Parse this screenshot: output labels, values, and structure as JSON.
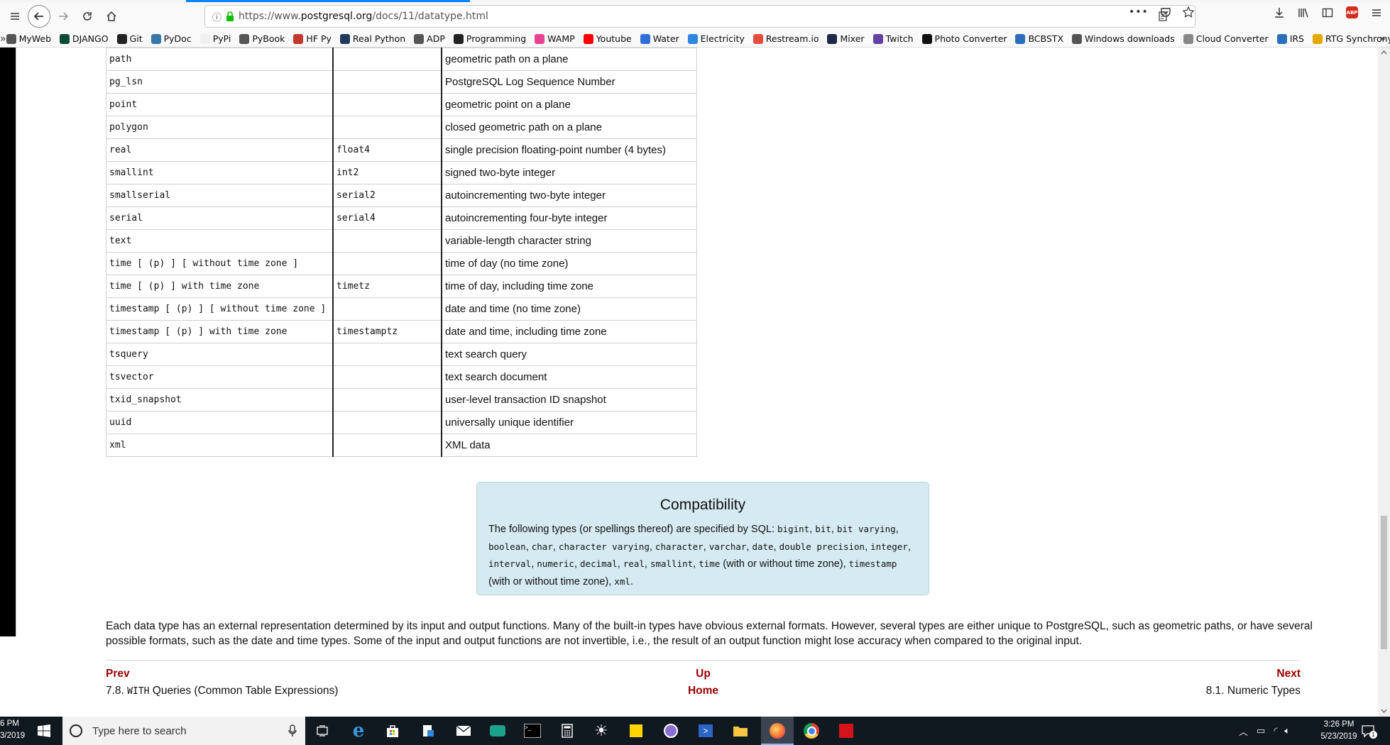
{
  "browser": {
    "url_prefix": "https://www.",
    "url_domain": "postgresql.org",
    "url_path": "/docs/11/datatype.html",
    "bookmarks": [
      {
        "label": "MyWeb",
        "icon": "globe-icon",
        "color": "#555555"
      },
      {
        "label": "DJANGO",
        "icon": "django-icon",
        "color": "#0c4b33"
      },
      {
        "label": "Git",
        "icon": "github-icon",
        "color": "#222222"
      },
      {
        "label": "PyDoc",
        "icon": "python-icon",
        "color": "#3776ab"
      },
      {
        "label": "PyPi",
        "icon": "pypi-icon",
        "color": "#f0f0f0"
      },
      {
        "label": "PyBook",
        "icon": "globe-icon",
        "color": "#555555"
      },
      {
        "label": "HF Py",
        "icon": "book-icon",
        "color": "#c0392b"
      },
      {
        "label": "Real Python",
        "icon": "realpython-icon",
        "color": "#1f3a5a"
      },
      {
        "label": "ADP",
        "icon": "globe-icon",
        "color": "#555555"
      },
      {
        "label": "Programming",
        "icon": "terminal-icon",
        "color": "#222222"
      },
      {
        "label": "WAMP",
        "icon": "wamp-icon",
        "color": "#e84393"
      },
      {
        "label": "Youtube",
        "icon": "youtube-icon",
        "color": "#ff0000"
      },
      {
        "label": "Water",
        "icon": "water-icon",
        "color": "#2e6fd8"
      },
      {
        "label": "Electricity",
        "icon": "bolt-icon",
        "color": "#2e86de"
      },
      {
        "label": "Restream.io",
        "icon": "restream-icon",
        "color": "#e74c3c"
      },
      {
        "label": "Mixer",
        "icon": "mixer-icon",
        "color": "#1c2b4a"
      },
      {
        "label": "Twitch",
        "icon": "twitch-icon",
        "color": "#6441a5"
      },
      {
        "label": "Photo Converter",
        "icon": "photo-icon",
        "color": "#111111"
      },
      {
        "label": "BCBSTX",
        "icon": "bcbs-icon",
        "color": "#2a6ebb"
      },
      {
        "label": "Windows downloads",
        "icon": "folder-icon",
        "color": "#555555"
      },
      {
        "label": "Cloud Converter",
        "icon": "cloud-icon",
        "color": "#888888"
      },
      {
        "label": "IRS",
        "icon": "irs-icon",
        "color": "#2a6ebb"
      },
      {
        "label": "RTG Synchrony",
        "icon": "rtg-icon",
        "color": "#e6a700"
      }
    ]
  },
  "table_rows": [
    {
      "name": "path",
      "alias": "",
      "desc": "geometric path on a plane"
    },
    {
      "name": "pg_lsn",
      "alias": "",
      "desc": "PostgreSQL Log Sequence Number"
    },
    {
      "name": "point",
      "alias": "",
      "desc": "geometric point on a plane"
    },
    {
      "name": "polygon",
      "alias": "",
      "desc": "closed geometric path on a plane"
    },
    {
      "name": "real",
      "alias": "float4",
      "desc": "single precision floating-point number (4 bytes)"
    },
    {
      "name": "smallint",
      "alias": "int2",
      "desc": "signed two-byte integer"
    },
    {
      "name": "smallserial",
      "alias": "serial2",
      "desc": "autoincrementing two-byte integer"
    },
    {
      "name": "serial",
      "alias": "serial4",
      "desc": "autoincrementing four-byte integer"
    },
    {
      "name": "text",
      "alias": "",
      "desc": "variable-length character string"
    },
    {
      "name": "time [ (p) ] [ without time zone ]",
      "alias": "",
      "desc": "time of day (no time zone)"
    },
    {
      "name": "time [ (p) ] with time zone",
      "alias": "timetz",
      "desc": "time of day, including time zone"
    },
    {
      "name": "timestamp [ (p) ] [ without time zone ]",
      "alias": "",
      "desc": "date and time (no time zone)"
    },
    {
      "name": "timestamp [ (p) ] with time zone",
      "alias": "timestamptz",
      "desc": "date and time, including time zone"
    },
    {
      "name": "tsquery",
      "alias": "",
      "desc": "text search query"
    },
    {
      "name": "tsvector",
      "alias": "",
      "desc": "text search document"
    },
    {
      "name": "txid_snapshot",
      "alias": "",
      "desc": "user-level transaction ID snapshot"
    },
    {
      "name": "uuid",
      "alias": "",
      "desc": "universally unique identifier"
    },
    {
      "name": "xml",
      "alias": "",
      "desc": "XML data"
    }
  ],
  "compat": {
    "title": "Compatibility",
    "intro": "The following types (or spellings thereof) are specified by SQL: ",
    "types1": [
      "bigint",
      "bit",
      "bit varying",
      "boolean",
      "char",
      "character varying",
      "character",
      "varchar",
      "date",
      "double precision",
      "integer",
      "interval",
      "numeric",
      "decimal",
      "real",
      "smallint"
    ],
    "time_code": "time",
    "with_without": " (with or without time zone), ",
    "timestamp_code": "timestamp",
    "with_without2": " (with or without time zone), ",
    "xml_code": "xml",
    "end": "."
  },
  "paragraph": "Each data type has an external representation determined by its input and output functions. Many of the built-in types have obvious external formats. However, several types are either unique to PostgreSQL, such as geometric paths, or have several possible formats, such as the date and time types. Some of the input and output functions are not invertible, i.e., the result of an output function might lose accuracy when compared to the original input.",
  "footer": {
    "prev_label": "Prev",
    "prev_num": "7.8. ",
    "prev_code": "WITH",
    "prev_rest": " Queries (Common Table Expressions)",
    "up_label": "Up",
    "home_label": "Home",
    "next_label": "Next",
    "next_title": "8.1. Numeric Types"
  },
  "taskbar": {
    "left_time": "6 PM",
    "left_date": "3/2019",
    "search_placeholder": "Type here to search",
    "time": "3:26 PM",
    "date": "5/23/2019",
    "notifications": "1"
  }
}
